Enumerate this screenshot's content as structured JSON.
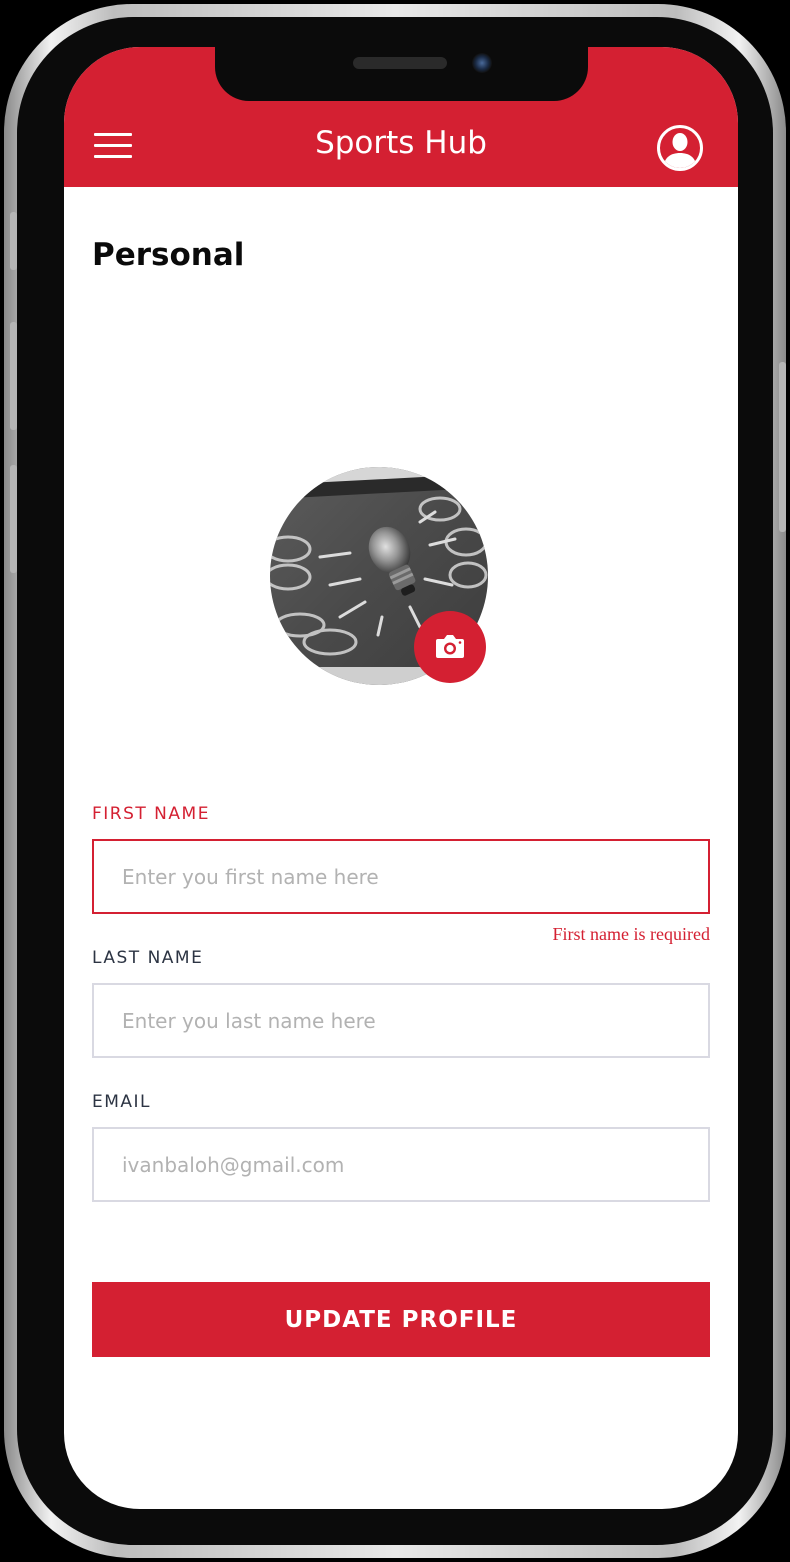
{
  "header": {
    "title": "Sports Hub",
    "menu_icon": "hamburger-menu-icon",
    "profile_icon": "user-silhouette-icon"
  },
  "section": {
    "title": "Personal"
  },
  "avatar": {
    "image": "light bulb on chalkboard photo",
    "camera_icon": "camera-icon"
  },
  "form": {
    "first_name": {
      "label": "FIRST NAME",
      "placeholder": "Enter you first name here",
      "value": "",
      "error": "First name is required"
    },
    "last_name": {
      "label": "LAST NAME",
      "placeholder": "Enter you last name here",
      "value": ""
    },
    "email": {
      "label": "EMAIL",
      "placeholder": "ivanbaloh@gmail.com",
      "value": ""
    }
  },
  "actions": {
    "update_label": "UPDATE PROFILE"
  },
  "colors": {
    "accent": "#d42032",
    "label": "#2c3443",
    "border": "#d9d9e2",
    "placeholder": "#b2b2b2"
  }
}
